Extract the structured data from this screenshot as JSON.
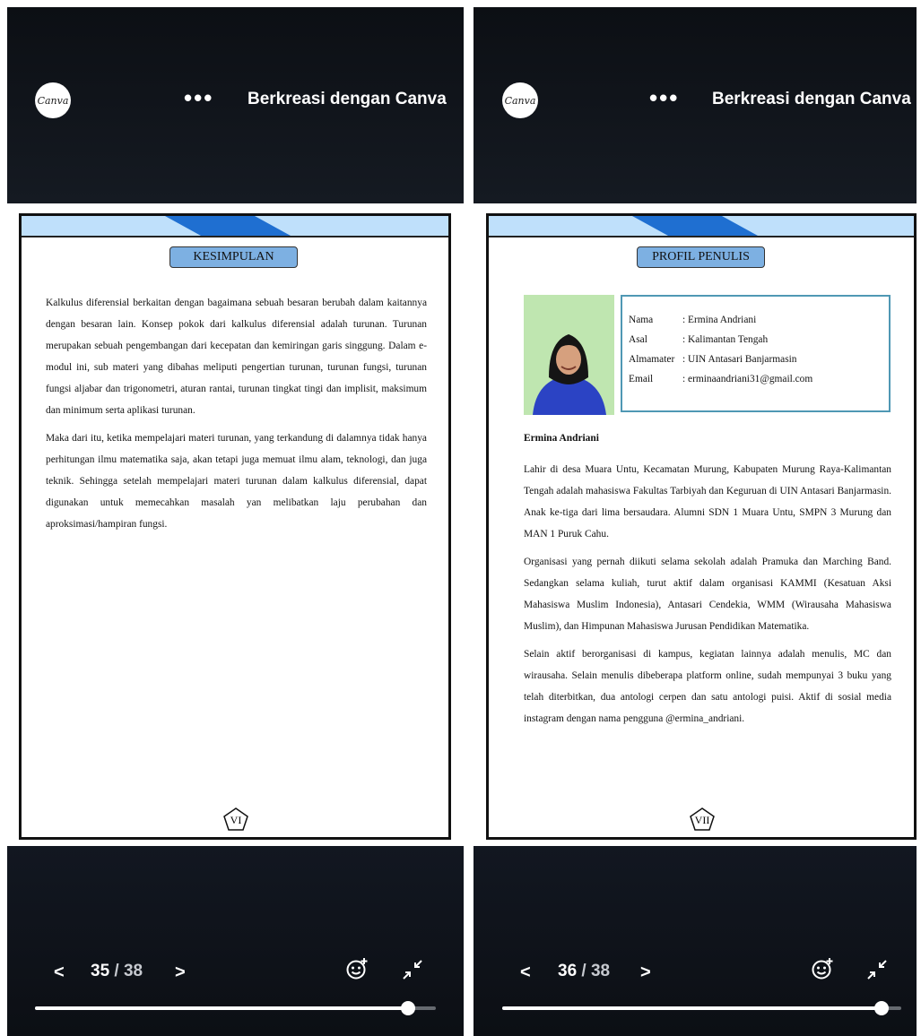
{
  "app": {
    "logo_text": "Canva",
    "more_label": "•••",
    "title": "Berkreasi dengan Canva",
    "prev_label": "<",
    "next_label": ">",
    "sticker_icon": "add-reaction-icon",
    "collapse_icon": "collapse-icon"
  },
  "left": {
    "current_page": "35",
    "total_pages": "/ 38",
    "progress": 0.93,
    "heading": "KESIMPULAN",
    "paragraphs": [
      "Kalkulus diferensial berkaitan dengan bagaimana sebuah besaran berubah dalam kaitannya dengan besaran lain. Konsep pokok dari kalkulus diferensial adalah turunan. Turunan merupakan sebuah pengembangan dari kecepatan dan kemiringan garis singgung. Dalam e-modul ini, sub materi yang dibahas meliputi pengertian turunan, turunan fungsi, turunan fungsi aljabar dan trigonometri, aturan rantai, turunan tingkat tingi dan implisit, maksimum dan minimum serta aplikasi turunan.",
      "Maka dari itu, ketika mempelajari materi turunan, yang terkandung di dalamnya tidak hanya perhitungan ilmu matematika saja, akan tetapi juga memuat ilmu alam, teknologi, dan juga teknik. Sehingga setelah mempelajari materi turunan dalam kalkulus diferensial, dapat digunakan untuk memecahkan masalah yan melibatkan laju perubahan dan aproksimasi/hampiran fungsi."
    ],
    "page_number": "VI"
  },
  "right": {
    "current_page": "36",
    "total_pages": "/ 38",
    "progress": 0.95,
    "heading": "PROFIL PENULIS",
    "profile": [
      {
        "key": "Nama",
        "value": ": Ermina Andriani"
      },
      {
        "key": "Asal",
        "value": ": Kalimantan Tengah"
      },
      {
        "key": "Almamater",
        "value": ": UIN Antasari Banjarmasin"
      },
      {
        "key": "Email",
        "value": ": erminaandriani31@gmail.com"
      }
    ],
    "author_name": "Ermina Andriani",
    "paragraphs": [
      "Lahir di desa Muara Untu, Kecamatan Murung, Kabupaten Murung Raya-Kalimantan Tengah adalah mahasiswa Fakultas Tarbiyah dan Keguruan di UIN Antasari Banjarmasin. Anak ke-tiga dari lima bersaudara. Alumni SDN 1 Muara Untu, SMPN 3 Murung dan MAN 1 Puruk Cahu.",
      "Organisasi yang pernah diikuti selama sekolah adalah Pramuka dan Marching Band. Sedangkan selama kuliah, turut aktif dalam organisasi KAMMI (Kesatuan Aksi Mahasiswa Muslim Indonesia), Antasari Cendekia, WMM (Wirausaha Mahasiswa Muslim), dan Himpunan Mahasiswa Jurusan Pendidikan Matematika.",
      "Selain aktif berorganisasi di kampus, kegiatan lainnya adalah menulis, MC dan wirausaha. Selain menulis dibeberapa platform online, sudah mempunyai 3 buku yang telah diterbitkan, dua antologi cerpen dan satu antologi puisi. Aktif di sosial media instagram dengan nama pengguna @ermina_andriani."
    ],
    "page_number": "VII"
  }
}
